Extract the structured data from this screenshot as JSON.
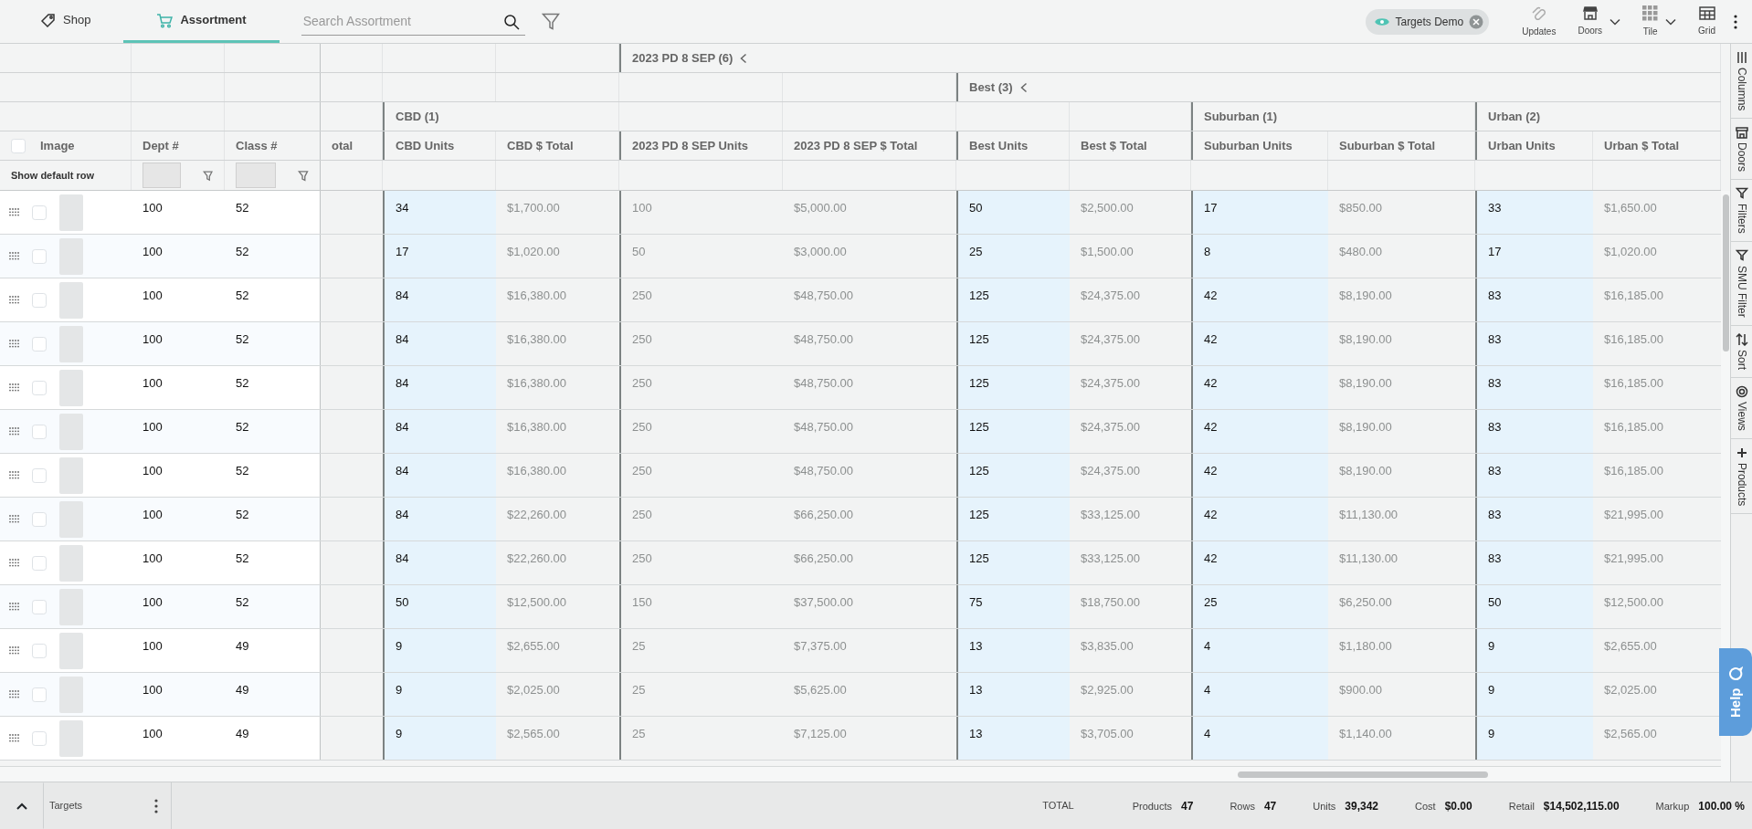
{
  "nav_tabs": [
    {
      "label": "Shop",
      "selected": false
    },
    {
      "label": "Assortment",
      "selected": true
    }
  ],
  "search": {
    "placeholder": "Search Assortment"
  },
  "filter_chip": {
    "label": "Targets Demo"
  },
  "toolbar": [
    {
      "label": "Updates",
      "dropdown": false
    },
    {
      "label": "Doors",
      "dropdown": true
    },
    {
      "label": "Tile",
      "dropdown": true
    },
    {
      "label": "Grid",
      "dropdown": false
    }
  ],
  "table": {
    "select_all_checked": false,
    "pinned_columns": [
      {
        "label": "Image"
      },
      {
        "label": "Dept #"
      },
      {
        "label": "Class #"
      }
    ],
    "filter_row": {
      "label": "Show default row"
    },
    "columns": [
      {
        "label": "otal",
        "kind": "partial"
      },
      {
        "label": "CBD (1)",
        "collapsible": false,
        "children": [
          {
            "label": "CBD Units",
            "kind": "units",
            "highlighted": true
          },
          {
            "label": "CBD $ Total",
            "kind": "amount",
            "highlighted": false
          }
        ]
      },
      {
        "label": "2023 PD 8 SEP (6)",
        "collapsible": true,
        "children": [
          {
            "label": "2023 PD 8 SEP Units",
            "kind": "units",
            "highlighted": false
          },
          {
            "label": "2023 PD 8 SEP $ Total",
            "kind": "amount",
            "highlighted": false
          },
          {
            "label": "Best (3)",
            "collapsible": true,
            "children": [
              {
                "label": "Best Units",
                "kind": "units",
                "highlighted": true
              },
              {
                "label": "Best $ Total",
                "kind": "amount",
                "highlighted": false
              },
              {
                "label": "Suburban (1)",
                "collapsible": false,
                "children": [
                  {
                    "label": "Suburban Units",
                    "kind": "units",
                    "highlighted": true
                  },
                  {
                    "label": "Suburban $ Total",
                    "kind": "amount",
                    "highlighted": false
                  }
                ]
              },
              {
                "label": "Urban (2)",
                "collapsible": false,
                "children": [
                  {
                    "label": "Urban Units",
                    "kind": "units",
                    "highlighted": true
                  },
                  {
                    "label": "Urban $ Total",
                    "kind": "amount",
                    "highlighted": false
                  }
                ]
              }
            ]
          }
        ]
      }
    ],
    "rows": [
      {
        "checked": false,
        "dept": "100",
        "class": "52",
        "values": [
          "34",
          "$1,700.00",
          "100",
          "$5,000.00",
          "50",
          "$2,500.00",
          "17",
          "$850.00",
          "33",
          "$1,650.00"
        ]
      },
      {
        "checked": false,
        "dept": "100",
        "class": "52",
        "values": [
          "17",
          "$1,020.00",
          "50",
          "$3,000.00",
          "25",
          "$1,500.00",
          "8",
          "$480.00",
          "17",
          "$1,020.00"
        ]
      },
      {
        "checked": false,
        "dept": "100",
        "class": "52",
        "values": [
          "84",
          "$16,380.00",
          "250",
          "$48,750.00",
          "125",
          "$24,375.00",
          "42",
          "$8,190.00",
          "83",
          "$16,185.00"
        ]
      },
      {
        "checked": false,
        "dept": "100",
        "class": "52",
        "values": [
          "84",
          "$16,380.00",
          "250",
          "$48,750.00",
          "125",
          "$24,375.00",
          "42",
          "$8,190.00",
          "83",
          "$16,185.00"
        ]
      },
      {
        "checked": false,
        "dept": "100",
        "class": "52",
        "values": [
          "84",
          "$16,380.00",
          "250",
          "$48,750.00",
          "125",
          "$24,375.00",
          "42",
          "$8,190.00",
          "83",
          "$16,185.00"
        ]
      },
      {
        "checked": false,
        "dept": "100",
        "class": "52",
        "values": [
          "84",
          "$16,380.00",
          "250",
          "$48,750.00",
          "125",
          "$24,375.00",
          "42",
          "$8,190.00",
          "83",
          "$16,185.00"
        ]
      },
      {
        "checked": false,
        "dept": "100",
        "class": "52",
        "values": [
          "84",
          "$16,380.00",
          "250",
          "$48,750.00",
          "125",
          "$24,375.00",
          "42",
          "$8,190.00",
          "83",
          "$16,185.00"
        ]
      },
      {
        "checked": false,
        "dept": "100",
        "class": "52",
        "values": [
          "84",
          "$22,260.00",
          "250",
          "$66,250.00",
          "125",
          "$33,125.00",
          "42",
          "$11,130.00",
          "83",
          "$21,995.00"
        ]
      },
      {
        "checked": false,
        "dept": "100",
        "class": "52",
        "values": [
          "84",
          "$22,260.00",
          "250",
          "$66,250.00",
          "125",
          "$33,125.00",
          "42",
          "$11,130.00",
          "83",
          "$21,995.00"
        ]
      },
      {
        "checked": false,
        "dept": "100",
        "class": "52",
        "values": [
          "50",
          "$12,500.00",
          "150",
          "$37,500.00",
          "75",
          "$18,750.00",
          "25",
          "$6,250.00",
          "50",
          "$12,500.00"
        ]
      },
      {
        "checked": false,
        "dept": "100",
        "class": "49",
        "values": [
          "9",
          "$2,655.00",
          "25",
          "$7,375.00",
          "13",
          "$3,835.00",
          "4",
          "$1,180.00",
          "9",
          "$2,655.00"
        ]
      },
      {
        "checked": false,
        "dept": "100",
        "class": "49",
        "values": [
          "9",
          "$2,025.00",
          "25",
          "$5,625.00",
          "13",
          "$2,925.00",
          "4",
          "$900.00",
          "9",
          "$2,025.00"
        ]
      },
      {
        "checked": false,
        "dept": "100",
        "class": "49",
        "values": [
          "9",
          "$2,565.00",
          "25",
          "$7,125.00",
          "13",
          "$3,705.00",
          "4",
          "$1,140.00",
          "9",
          "$2,565.00"
        ]
      }
    ]
  },
  "side_panel": [
    {
      "label": "Columns"
    },
    {
      "label": "Doors"
    },
    {
      "label": "Filters"
    },
    {
      "label": "SMU Filter"
    },
    {
      "label": "Sort"
    },
    {
      "label": "Views"
    },
    {
      "label": "Products"
    }
  ],
  "help_button": {
    "label": "Help"
  },
  "footer": {
    "panel_label": "Targets",
    "total_label": "TOTAL",
    "totals": [
      {
        "label": "Products",
        "value": "47"
      },
      {
        "label": "Rows",
        "value": "47"
      },
      {
        "label": "Units",
        "value": "39,342"
      },
      {
        "label": "Cost",
        "value": "$0.00"
      },
      {
        "label": "Retail",
        "value": "$14,502,115.00"
      },
      {
        "label": "Markup",
        "value": "100.00 %"
      }
    ]
  }
}
